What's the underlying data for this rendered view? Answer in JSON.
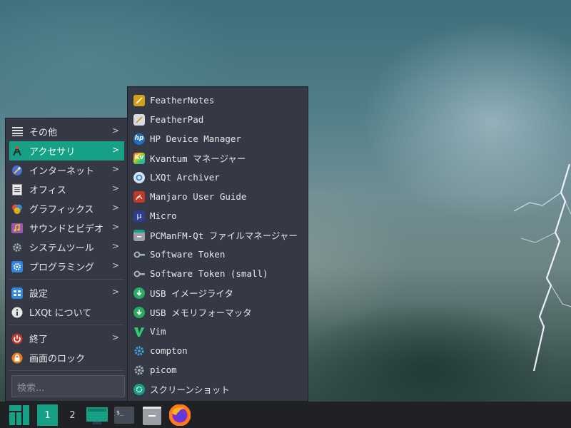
{
  "menu": {
    "categories": [
      {
        "label": "その他",
        "icon": "list-icon"
      },
      {
        "label": "アクセサリ",
        "icon": "accessories-icon",
        "active": true
      },
      {
        "label": "インターネット",
        "icon": "globe-icon"
      },
      {
        "label": "オフィス",
        "icon": "document-icon"
      },
      {
        "label": "グラフィックス",
        "icon": "graphics-icon"
      },
      {
        "label": "サウンドとビデオ",
        "icon": "multimedia-icon"
      },
      {
        "label": "システムツール",
        "icon": "gear-icon"
      },
      {
        "label": "プログラミング",
        "icon": "programming-icon"
      }
    ],
    "settings": {
      "label": "設定",
      "icon": "settings-icon"
    },
    "about": {
      "label": "LXQt について",
      "icon": "info-icon"
    },
    "shutdown": {
      "label": "終了",
      "icon": "power-icon"
    },
    "lock": {
      "label": "画面のロック",
      "icon": "lock-icon"
    },
    "search_placeholder": "検索..."
  },
  "submenu": {
    "items": [
      {
        "label": "FeatherNotes",
        "icon": "feathernotes-icon"
      },
      {
        "label": "FeatherPad",
        "icon": "featherpad-icon"
      },
      {
        "label": "HP Device Manager",
        "icon": "hp-icon"
      },
      {
        "label": "Kvantum マネージャー",
        "icon": "kvantum-icon"
      },
      {
        "label": "LXQt Archiver",
        "icon": "archiver-icon"
      },
      {
        "label": "Manjaro User Guide",
        "icon": "pdf-icon"
      },
      {
        "label": "Micro",
        "icon": "micro-icon"
      },
      {
        "label": "PCManFM-Qt ファイルマネージャー",
        "icon": "file-manager-icon"
      },
      {
        "label": "Software Token",
        "icon": "key-icon"
      },
      {
        "label": "Software Token (small)",
        "icon": "key-icon"
      },
      {
        "label": "USB イメージライタ",
        "icon": "download-icon"
      },
      {
        "label": "USB メモリフォーマッタ",
        "icon": "download-icon"
      },
      {
        "label": "Vim",
        "icon": "vim-icon"
      },
      {
        "label": "compton",
        "icon": "gear-icon"
      },
      {
        "label": "picom",
        "icon": "gear-icon"
      },
      {
        "label": "スクリーンショット",
        "icon": "screenshot-icon"
      }
    ]
  },
  "taskbar": {
    "workspace_1": "1",
    "workspace_2": "2",
    "terminal_glyph": "$_",
    "launchers": [
      "manjaro-menu-icon",
      "desktop-icon",
      "terminal-icon",
      "file-manager-icon",
      "firefox-icon"
    ]
  },
  "colors": {
    "accent": "#16a085",
    "menu_bg": "#353945",
    "taskbar_bg": "#1f2125"
  }
}
